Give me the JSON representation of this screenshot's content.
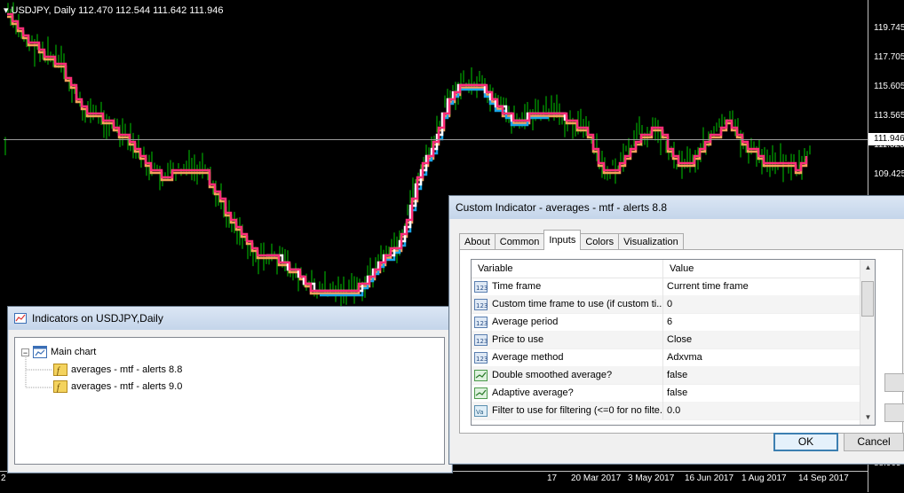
{
  "chart": {
    "symbol_line": "USDJPY, Daily  112.470 112.544 111.642 111.946",
    "current_price": "111.946",
    "price_levels": [
      "119.745",
      "117.705",
      "115.605",
      "113.565",
      "111.525",
      "109.425",
      "88.905"
    ],
    "time_labels": [
      "20 Mar 2017",
      "3 May 2017",
      "16 Jun 2017",
      "1 Aug 2017",
      "14 Sep 2017"
    ],
    "time_label_left_cut": "2",
    "time_label_mid_cut": "17",
    "colors": {
      "candles": "#00c800",
      "line_pink": "#ff2d7a",
      "line_orange": "#f5a05a",
      "line_blue": "#1aa6e8",
      "line_white": "#ffffff"
    }
  },
  "indicators_window": {
    "title": "Indicators on USDJPY,Daily",
    "root_label": "Main chart",
    "items": [
      {
        "label": "averages - mtf - alerts  8.8"
      },
      {
        "label": "averages - mtf - alerts  9.0"
      }
    ]
  },
  "custom_indicator": {
    "title": "Custom Indicator - averages - mtf - alerts  8.8",
    "tabs": [
      "About",
      "Common",
      "Inputs",
      "Colors",
      "Visualization"
    ],
    "active_tab": "Inputs",
    "columns": {
      "variable": "Variable",
      "value": "Value"
    },
    "rows": [
      {
        "icon": "int-icon",
        "variable": "Time frame",
        "value": "Current time frame"
      },
      {
        "icon": "int-icon",
        "variable": "Custom time frame to use (if custom ti...",
        "value": "0"
      },
      {
        "icon": "int-icon",
        "variable": "Average period",
        "value": "6"
      },
      {
        "icon": "int-icon",
        "variable": "Price to use",
        "value": "Close"
      },
      {
        "icon": "int-icon",
        "variable": "Average method",
        "value": "Adxvma"
      },
      {
        "icon": "bool-icon",
        "variable": "Double smoothed average?",
        "value": "false"
      },
      {
        "icon": "bool-icon",
        "variable": "Adaptive average?",
        "value": "false"
      },
      {
        "icon": "double-icon",
        "variable": "Filter to use for filtering (<=0 for no filte...",
        "value": "0.0"
      }
    ],
    "ok_label": "OK",
    "cancel_label": "Cancel"
  }
}
